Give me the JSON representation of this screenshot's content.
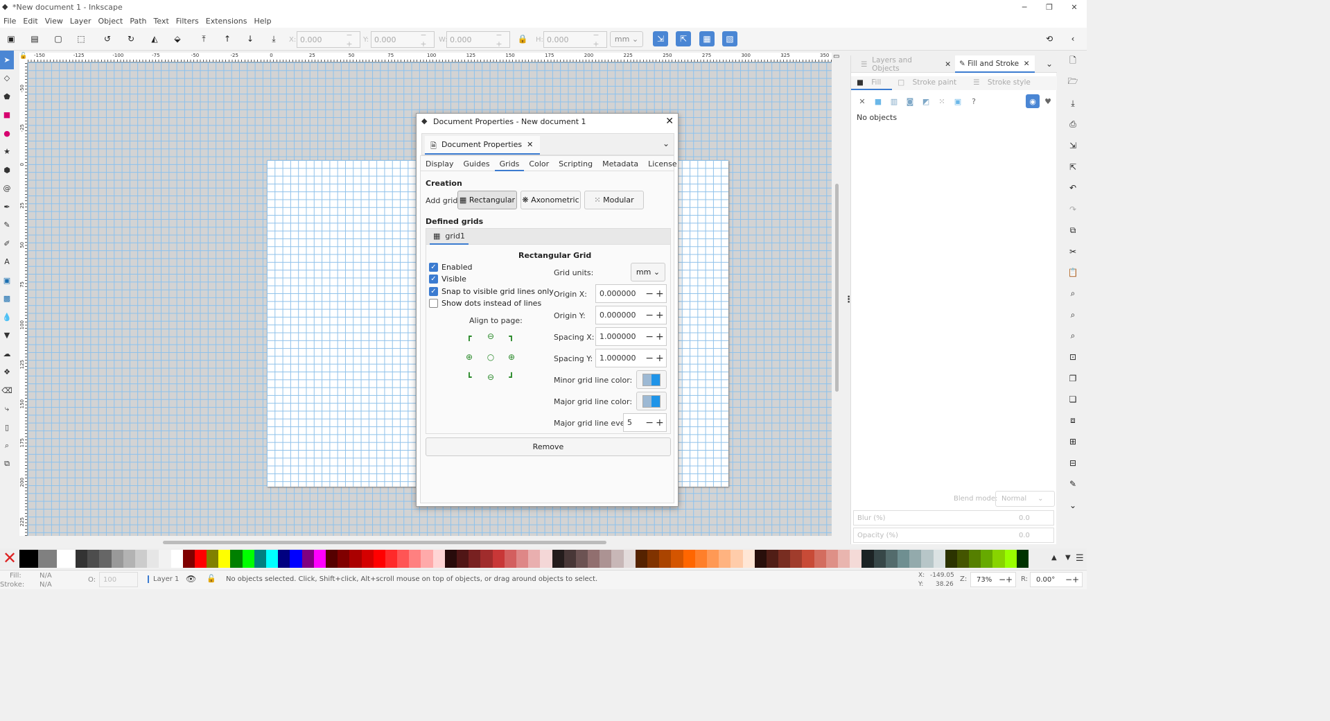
{
  "window": {
    "title": "*New document 1 - Inkscape",
    "min": "─",
    "max": "❐",
    "close": "✕"
  },
  "menu": [
    "File",
    "Edit",
    "View",
    "Layer",
    "Object",
    "Path",
    "Text",
    "Filters",
    "Extensions",
    "Help"
  ],
  "toolbar": {
    "x_label": "X:",
    "x": "0.000",
    "y_label": "Y:",
    "y": "0.000",
    "w_label": "W:",
    "w": "0.000",
    "h_label": "H:",
    "h": "0.000",
    "units": "mm"
  },
  "ruler": {
    "h_labels": [
      "-150",
      "-125",
      "-100",
      "-75",
      "-50",
      "-25",
      "0",
      "25",
      "50",
      "75",
      "100",
      "125",
      "150",
      "175",
      "200",
      "225",
      "250",
      "275",
      "300",
      "325",
      "350"
    ],
    "v_labels": [
      "-50",
      "-25",
      "0",
      "25",
      "50",
      "75",
      "100",
      "125",
      "150",
      "175",
      "200",
      "225"
    ]
  },
  "dialog": {
    "title": "Document Properties - New document 1",
    "dock_tab": "Document Properties",
    "tabs": [
      "Display",
      "Guides",
      "Grids",
      "Color",
      "Scripting",
      "Metadata",
      "License"
    ],
    "selected_tab": "Grids",
    "creation": "Creation",
    "add_grid": "Add grid:",
    "btn_rect": "Rectangular",
    "btn_axo": "Axonometric",
    "btn_mod": "Modular",
    "defined": "Defined grids",
    "grid_tab": "grid1",
    "grid_heading": "Rectangular Grid",
    "enabled": "Enabled",
    "visible": "Visible",
    "snap": "Snap to visible grid lines only",
    "dots": "Show dots instead of lines",
    "align": "Align to page:",
    "units_label": "Grid units:",
    "units": "mm",
    "originx_label": "Origin X:",
    "originx": "0.000000",
    "originy_label": "Origin Y:",
    "originy": "0.000000",
    "spacingx_label": "Spacing X:",
    "spacingx": "1.000000",
    "spacingy_label": "Spacing Y:",
    "spacingy": "1.000000",
    "minor_label": "Minor grid line color:",
    "major_label": "Major grid line color:",
    "every_label": "Major grid line every:",
    "every": "5",
    "remove": "Remove"
  },
  "dock": {
    "tab1": "Layers and Objects",
    "tab2": "Fill and Stroke",
    "sub": [
      "Fill",
      "Stroke paint",
      "Stroke style"
    ],
    "no_objects": "No objects",
    "blend_label": "Blend mode:",
    "blend": "Normal",
    "blur_label": "Blur (%)",
    "blur": "0.0",
    "opacity_label": "Opacity (%)",
    "opacity": "0.0"
  },
  "status": {
    "fill_label": "Fill:",
    "fill": "N/A",
    "stroke_label": "Stroke:",
    "stroke": "N/A",
    "o_label": "O:",
    "o": "100",
    "layer": "Layer 1",
    "message": "No objects selected. Click, Shift+click, Alt+scroll mouse on top of objects, or drag around objects to select.",
    "x_label": "X:",
    "x": "-149.05",
    "y_label": "Y:",
    "y": "38.26",
    "z_label": "Z:",
    "zoom": "73%",
    "r_label": "R:",
    "rotation": "0.00°"
  },
  "palette": [
    "#000000",
    "#808080",
    "#ffffff",
    "#333333",
    "#4d4d4d",
    "#666666",
    "#999999",
    "#b3b3b3",
    "#cccccc",
    "#e6e6e6",
    "#f2f2f2",
    "#ffffff",
    "#800000",
    "#ff0000",
    "#808000",
    "#ffff00",
    "#008000",
    "#00ff00",
    "#008080",
    "#00ffff",
    "#000080",
    "#0000ff",
    "#800080",
    "#ff00ff",
    "#550000",
    "#800000",
    "#aa0000",
    "#d40000",
    "#ff0000",
    "#ff2a2a",
    "#ff5555",
    "#ff8080",
    "#ffaaaa",
    "#ffd5d5",
    "#280b0b",
    "#501616",
    "#782121",
    "#a02c2c",
    "#c83737",
    "#d35f5f",
    "#de8787",
    "#e9afaf",
    "#f4d7d7",
    "#241c1c",
    "#483737",
    "#6c5353",
    "#916f6f",
    "#ac9393",
    "#c8b7b7",
    "#e3dbdb",
    "#552200",
    "#803300",
    "#aa4400",
    "#d45500",
    "#ff6600",
    "#ff7f2a",
    "#ff9955",
    "#ffb380",
    "#ffccaa",
    "#ffe6d5",
    "#280f0b",
    "#501e16",
    "#782d21",
    "#a03c2c",
    "#c84b37",
    "#d36d5f",
    "#de9087",
    "#e9b5af",
    "#f4dad7",
    "#1c2324",
    "#374748",
    "#536b6c",
    "#6f8f91",
    "#93aaac",
    "#b7c6c8",
    "#dbe2e3",
    "#2b3300",
    "#445500",
    "#557f00",
    "#66aa00",
    "#88d400",
    "#99ff00",
    "#003300"
  ]
}
